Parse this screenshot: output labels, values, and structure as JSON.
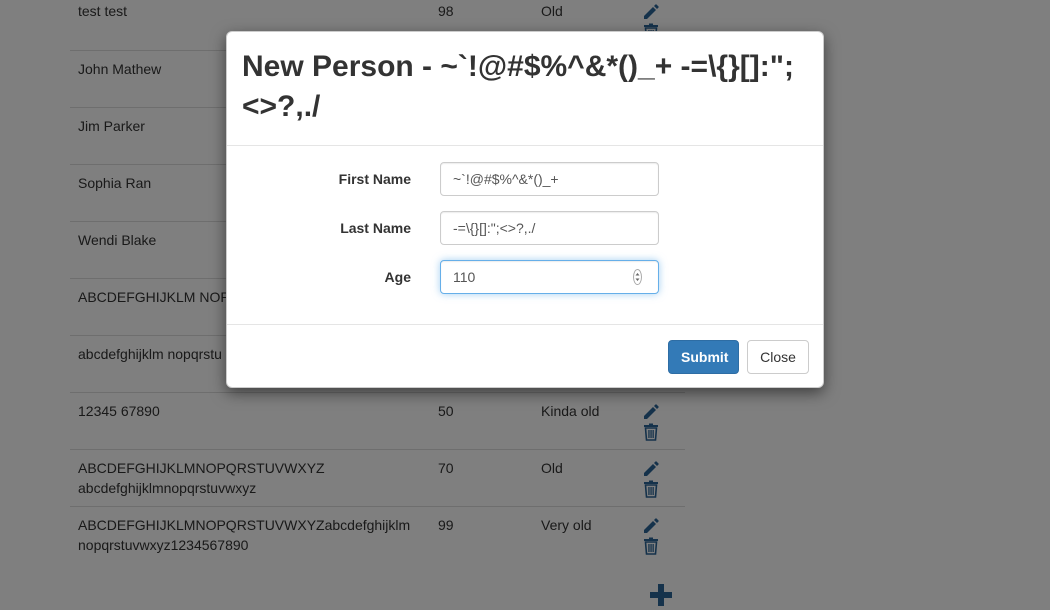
{
  "table": {
    "rows": [
      {
        "name": "test test",
        "age": "98",
        "status": "Old"
      },
      {
        "name": "John Mathew",
        "age": "",
        "status": ""
      },
      {
        "name": "Jim Parker",
        "age": "",
        "status": ""
      },
      {
        "name": "Sophia Ran",
        "age": "",
        "status": ""
      },
      {
        "name": "Wendi Blake",
        "age": "",
        "status": ""
      },
      {
        "name": "ABCDEFGHIJKLM NOP",
        "age": "",
        "status": ""
      },
      {
        "name": "abcdefghijklm nopqrstu",
        "age": "",
        "status": ""
      },
      {
        "name": "12345 67890",
        "age": "50",
        "status": "Kinda old"
      },
      {
        "name": "ABCDEFGHIJKLMNOPQRSTUVWXYZ abcdefghijklmnopqrstuvwxyz",
        "age": "70",
        "status": "Old"
      },
      {
        "name": "ABCDEFGHIJKLMNOPQRSTUVWXYZabcdefghijklm nopqrstuvwxyz1234567890",
        "age": "99",
        "status": "Very old"
      }
    ],
    "actions": {
      "edit_icon": "pencil-icon",
      "delete_icon": "trash-icon",
      "add_icon": "plus-icon"
    }
  },
  "modal": {
    "title": "New Person - ~`!@#$%^&*()_+ -=\\{}[]:\"; <>?,./",
    "fields": {
      "first_name": {
        "label": "First Name",
        "value": "~`!@#$%^&*()_+"
      },
      "last_name": {
        "label": "Last Name",
        "value": "-=\\{}[]:\";<>?,./"
      },
      "age": {
        "label": "Age",
        "value": "110"
      }
    },
    "buttons": {
      "submit": "Submit",
      "close": "Close"
    }
  },
  "colors": {
    "primary": "#337ab7",
    "icon": "#2a6496",
    "focus": "#66afe9"
  }
}
